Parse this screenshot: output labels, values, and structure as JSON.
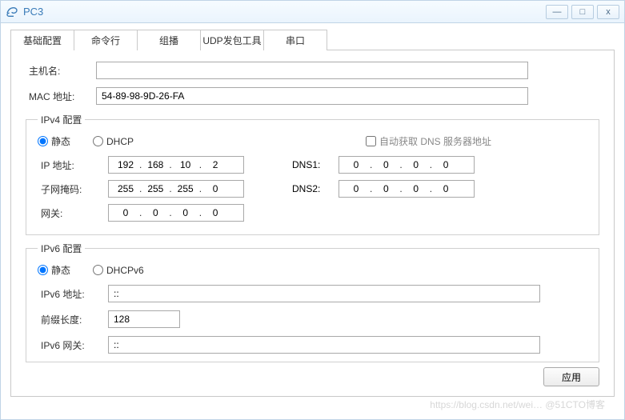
{
  "titlebar": {
    "title": "PC3"
  },
  "tabs": [
    {
      "label": "基础配置"
    },
    {
      "label": "命令行"
    },
    {
      "label": "组播"
    },
    {
      "label": "UDP发包工具"
    },
    {
      "label": "串口"
    }
  ],
  "basic": {
    "host_label": "主机名:",
    "host_value": "",
    "mac_label": "MAC 地址:",
    "mac_value": "54-89-98-9D-26-FA"
  },
  "ipv4": {
    "legend": "IPv4 配置",
    "radio_static": "静态",
    "radio_dhcp": "DHCP",
    "auto_dns_label": "自动获取 DNS 服务器地址",
    "ip_label": "IP 地址:",
    "ip": [
      "192",
      "168",
      "10",
      "2"
    ],
    "mask_label": "子网掩码:",
    "mask": [
      "255",
      "255",
      "255",
      "0"
    ],
    "gw_label": "网关:",
    "gw": [
      "0",
      "0",
      "0",
      "0"
    ],
    "dns1_label": "DNS1:",
    "dns1": [
      "0",
      "0",
      "0",
      "0"
    ],
    "dns2_label": "DNS2:",
    "dns2": [
      "0",
      "0",
      "0",
      "0"
    ]
  },
  "ipv6": {
    "legend": "IPv6 配置",
    "radio_static": "静态",
    "radio_dhcpv6": "DHCPv6",
    "addr_label": "IPv6 地址:",
    "addr_value": "::",
    "prefix_label": "前缀长度:",
    "prefix_value": "128",
    "gw_label": "IPv6 网关:",
    "gw_value": "::"
  },
  "footer": {
    "apply": "应用"
  },
  "watermark": "https://blog.csdn.net/wei… @51CTO博客"
}
